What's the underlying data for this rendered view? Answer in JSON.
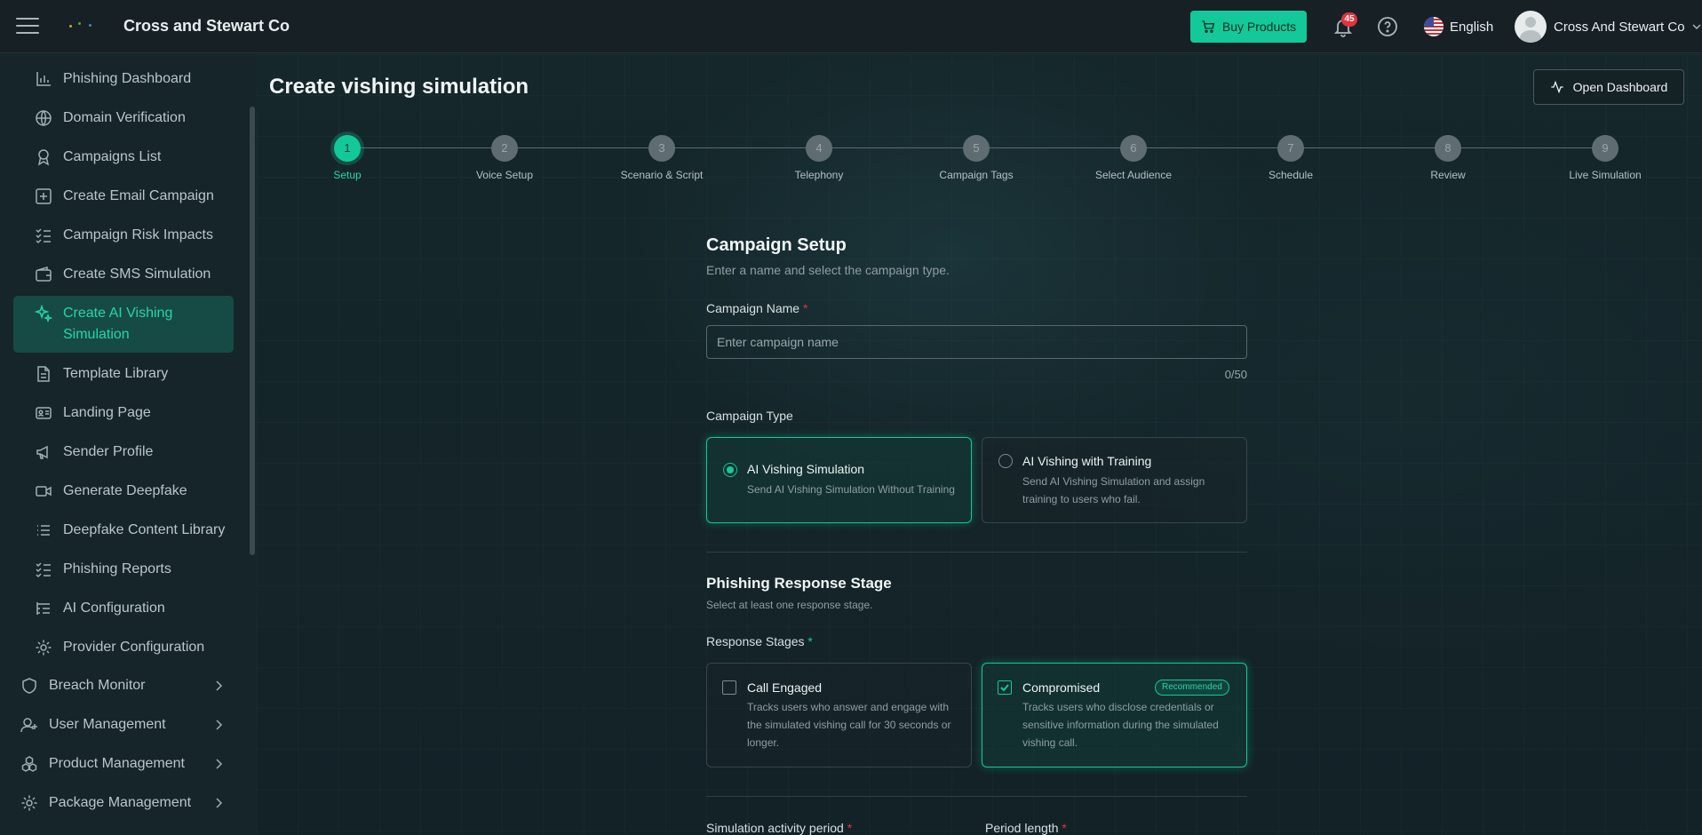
{
  "topbar": {
    "brand": "Cross and Stewart Co",
    "buy_label": "Buy Products",
    "notification_count": "45",
    "language": "English",
    "user_name": "Cross And Stewart Co"
  },
  "sidebar": {
    "items": [
      {
        "label": "Phishing Dashboard",
        "icon": "bar-chart-icon"
      },
      {
        "label": "Domain Verification",
        "icon": "globe-icon"
      },
      {
        "label": "Campaigns List",
        "icon": "award-icon"
      },
      {
        "label": "Create Email Campaign",
        "icon": "plus-square-icon"
      },
      {
        "label": "Campaign Risk Impacts",
        "icon": "checklist-icon"
      },
      {
        "label": "Create SMS Simulation",
        "icon": "wallet-icon"
      },
      {
        "label": "Create AI Vishing Simulation",
        "icon": "sparkles-icon",
        "active": true
      },
      {
        "label": "Template Library",
        "icon": "document-icon"
      },
      {
        "label": "Landing Page",
        "icon": "id-card-icon"
      },
      {
        "label": "Sender Profile",
        "icon": "megaphone-icon"
      },
      {
        "label": "Generate Deepfake",
        "icon": "video-icon"
      },
      {
        "label": "Deepfake Content Library",
        "icon": "list-icon"
      },
      {
        "label": "Phishing Reports",
        "icon": "checklist-icon"
      },
      {
        "label": "AI Configuration",
        "icon": "list-tree-icon"
      },
      {
        "label": "Provider Configuration",
        "icon": "gear-icon"
      }
    ],
    "groups": [
      {
        "label": "Breach Monitor",
        "icon": "shield-icon"
      },
      {
        "label": "User Management",
        "icon": "user-plus-icon"
      },
      {
        "label": "Product Management",
        "icon": "cubes-icon"
      },
      {
        "label": "Package Management",
        "icon": "gear-icon"
      }
    ]
  },
  "main": {
    "title": "Create vishing simulation",
    "open_dashboard_label": "Open Dashboard",
    "steps": [
      {
        "num": "1",
        "label": "Setup",
        "active": true
      },
      {
        "num": "2",
        "label": "Voice Setup"
      },
      {
        "num": "3",
        "label": "Scenario & Script"
      },
      {
        "num": "4",
        "label": "Telephony"
      },
      {
        "num": "5",
        "label": "Campaign Tags"
      },
      {
        "num": "6",
        "label": "Select Audience"
      },
      {
        "num": "7",
        "label": "Schedule"
      },
      {
        "num": "8",
        "label": "Review"
      },
      {
        "num": "9",
        "label": "Live Simulation"
      }
    ],
    "setup": {
      "heading": "Campaign Setup",
      "subheading": "Enter a name and select the campaign type.",
      "name_label": "Campaign Name",
      "name_placeholder": "Enter campaign name",
      "name_value": "",
      "name_counter": "0/50",
      "type_label": "Campaign Type",
      "types": [
        {
          "title": "AI Vishing Simulation",
          "desc": "Send AI Vishing Simulation Without Training",
          "selected": true
        },
        {
          "title": "AI Vishing with Training",
          "desc": "Send AI Vishing Simulation and assign training to users who fail.",
          "selected": false
        }
      ]
    },
    "response": {
      "heading": "Phishing Response Stage",
      "subheading": "Select at least one response stage.",
      "stages_label": "Response Stages",
      "stages": [
        {
          "title": "Call Engaged",
          "desc": "Tracks users who answer and engage with the simulated vishing call for 30 seconds or longer.",
          "checked": false,
          "badge": ""
        },
        {
          "title": "Compromised",
          "desc": "Tracks users who disclose credentials or sensitive information during the simulated vishing call.",
          "checked": true,
          "badge": "Recommended"
        }
      ]
    },
    "period": {
      "activity_label": "Simulation activity period",
      "length_label": "Period length"
    }
  },
  "colors": {
    "accent": "#13c99a",
    "danger": "#e0343e",
    "background": "#152226"
  }
}
